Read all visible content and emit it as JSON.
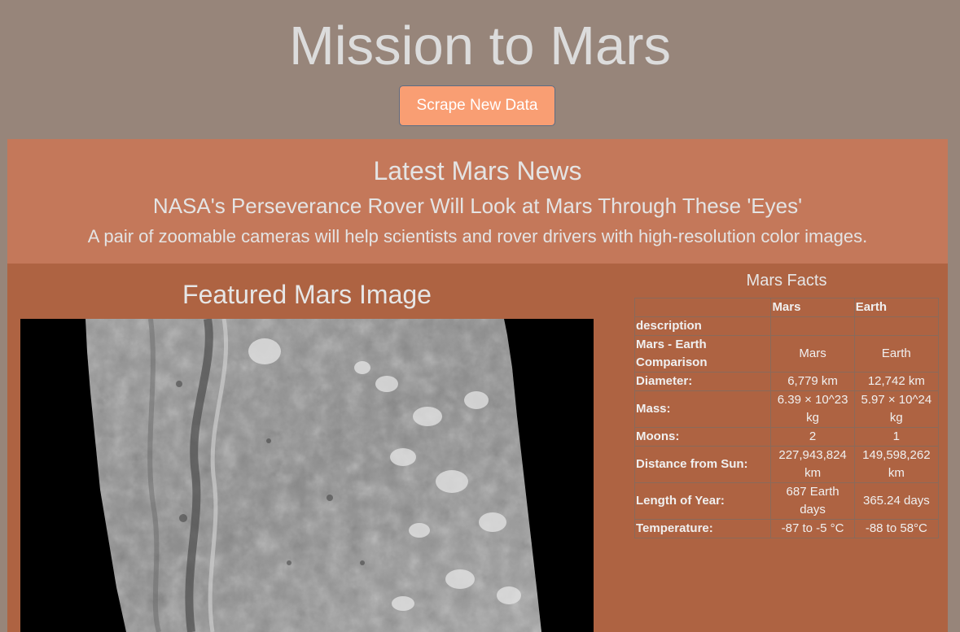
{
  "header": {
    "title": "Mission to Mars",
    "scrape_button": "Scrape New Data"
  },
  "news": {
    "heading": "Latest Mars News",
    "title": "NASA's Perseverance Rover Will Look at Mars Through These 'Eyes'",
    "teaser": "A pair of zoomable cameras will help scientists and rover drivers with high-resolution color images."
  },
  "featured": {
    "heading": "Featured Mars Image",
    "image_icon": "mars-surface-image"
  },
  "facts": {
    "heading": "Mars Facts",
    "columns": [
      "",
      "Mars",
      "Earth"
    ],
    "rows": [
      {
        "label": "description",
        "mars": "",
        "earth": ""
      },
      {
        "label": "Mars - Earth Comparison",
        "mars": "Mars",
        "earth": "Earth"
      },
      {
        "label": "Diameter:",
        "mars": "6,779 km",
        "earth": "12,742 km"
      },
      {
        "label": "Mass:",
        "mars": "6.39 × 10^23 kg",
        "earth": "5.97 × 10^24 kg"
      },
      {
        "label": "Moons:",
        "mars": "2",
        "earth": "1"
      },
      {
        "label": "Distance from Sun:",
        "mars": "227,943,824 km",
        "earth": "149,598,262 km"
      },
      {
        "label": "Length of Year:",
        "mars": "687 Earth days",
        "earth": "365.24 days"
      },
      {
        "label": "Temperature:",
        "mars": "-87 to -5 °C",
        "earth": "-88 to 58°C"
      }
    ]
  },
  "colors": {
    "page_bg": "#97857a",
    "news_bg": "#c4785a",
    "lower_bg": "#ae6342",
    "button_bg": "#f99e73"
  }
}
